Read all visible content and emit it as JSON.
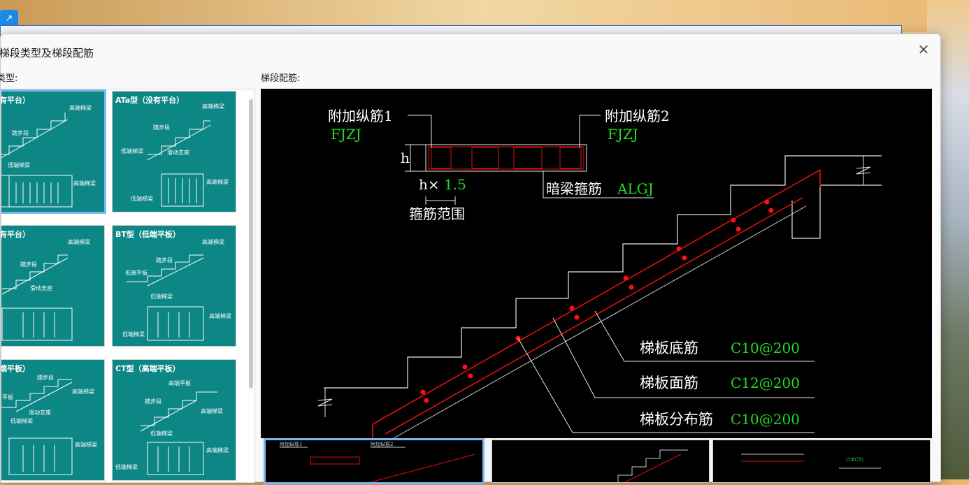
{
  "window": {
    "title": "梯段类型及梯段配筋"
  },
  "labels": {
    "type": "类型:",
    "rebar": "梯段配筋:"
  },
  "thumbnails": [
    {
      "title": "（没有平台）",
      "items": [
        "高端梯梁",
        "踏步段",
        "低端梯梁",
        "高端梯梁"
      ]
    },
    {
      "title": "ATa型（没有平台）",
      "items": [
        "高端梯梁",
        "踏步段",
        "低端梯梁",
        "滑动支座",
        "高端梯梁",
        "低端梯梁"
      ]
    },
    {
      "title": "（没有平台）",
      "items": [
        "高端梯梁",
        "踏步段",
        "滑动支座"
      ]
    },
    {
      "title": "BT型（低端平板）",
      "items": [
        "高端梯梁",
        "踏步段",
        "低端平板",
        "低端梯梁",
        "高端梯梁",
        "低端梯梁"
      ]
    },
    {
      "title": "（低端平板）",
      "items": [
        "踏步段",
        "高端梯梁",
        "平板",
        "滑动支座",
        "低端梯梁",
        "高端梯梁"
      ]
    },
    {
      "title": "CT型（高端平板）",
      "items": [
        "高端平板",
        "踏步段",
        "高端梯梁",
        "低端梯梁",
        "高端梯梁",
        "低端梯梁"
      ]
    }
  ],
  "diagram": {
    "add_rebar_1": "附加纵筋1",
    "add_rebar_1_code": "FJZJ",
    "add_rebar_2": "附加纵筋2",
    "add_rebar_2_code": "FJZJ",
    "h_label": "h",
    "h_factor_prefix": "h×",
    "h_factor_value": "1.5",
    "stirrup_range": "箍筋范围",
    "hidden_beam_stirrup": "暗梁箍筋",
    "hidden_beam_code": "ALGJ",
    "bottom_rebar": "梯板底筋",
    "bottom_rebar_value": "C10@200",
    "top_rebar": "梯板面筋",
    "top_rebar_value": "C12@200",
    "dist_rebar": "梯板分布筋",
    "dist_rebar_value": "C10@200"
  },
  "colors": {
    "teal": "#0d8686",
    "accent": "#7ab8ec",
    "cad_green": "#22dd22",
    "cad_red": "#e01010"
  }
}
